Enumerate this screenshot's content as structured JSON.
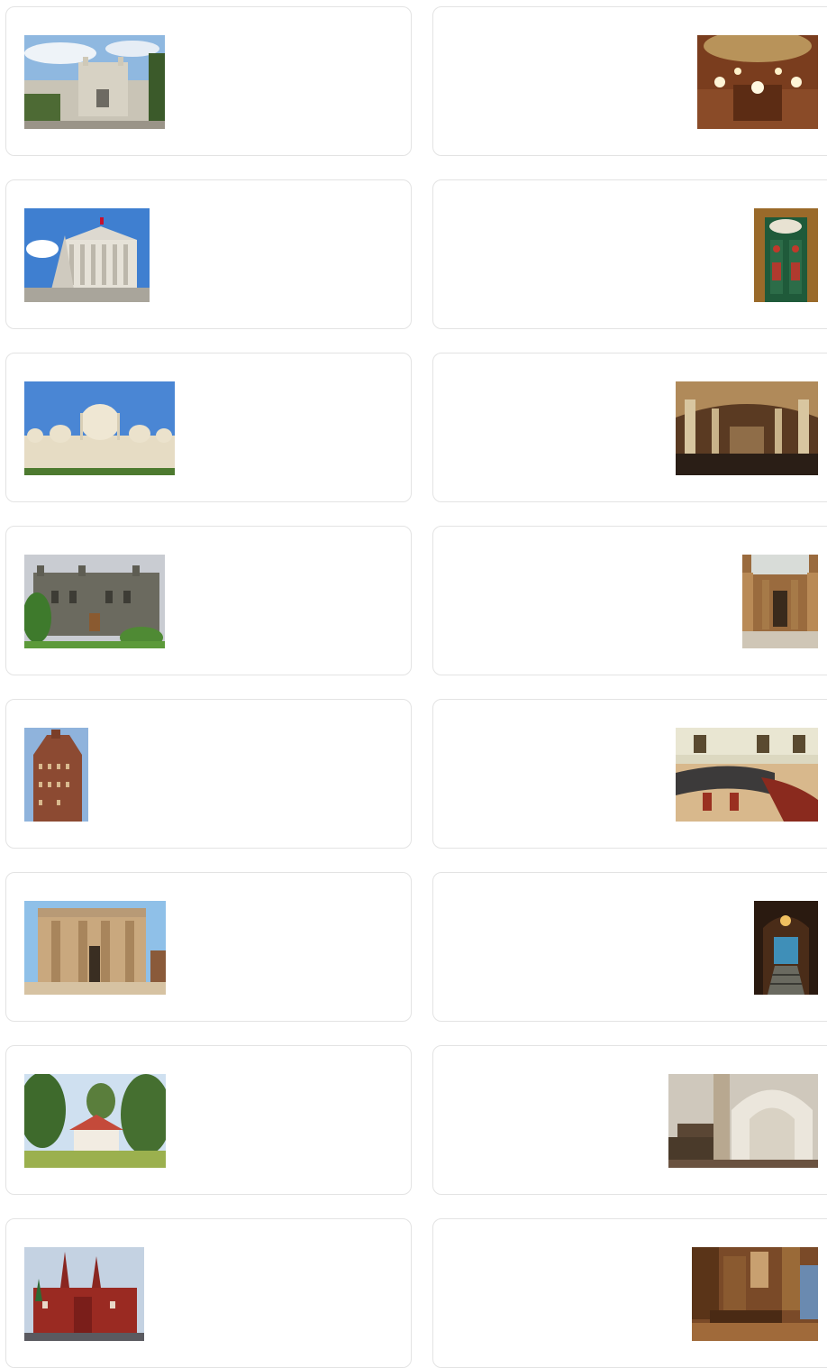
{
  "left_column": [
    {
      "alt": "palace-exterior-white-gothic"
    },
    {
      "alt": "parliament-building-vienna"
    },
    {
      "alt": "royal-pavilion-brighton"
    },
    {
      "alt": "gothic-palace-stone"
    },
    {
      "alt": "art-deco-tower"
    },
    {
      "alt": "egyptian-style-portico"
    },
    {
      "alt": "chinese-pavilion-park"
    },
    {
      "alt": "state-historical-museum-red-square"
    }
  ],
  "right_column": [
    {
      "alt": "chandelier-hall-interior"
    },
    {
      "alt": "ornate-green-doorway"
    },
    {
      "alt": "arched-gothic-hall-interior"
    },
    {
      "alt": "columned-hall-skylight"
    },
    {
      "alt": "assembly-hall-seats"
    },
    {
      "alt": "stained-glass-staircase"
    },
    {
      "alt": "carved-white-stone-interior"
    },
    {
      "alt": "wood-paneled-dining-room"
    }
  ]
}
